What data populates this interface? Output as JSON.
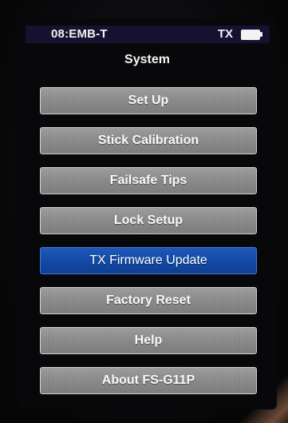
{
  "status_bar": {
    "model": "08:EMB-T",
    "mode": "TX",
    "battery_icon": "battery-full-icon"
  },
  "page": {
    "title": "System"
  },
  "menu": {
    "selected_index": 4,
    "items": [
      {
        "label": "Set Up"
      },
      {
        "label": "Stick Calibration"
      },
      {
        "label": "Failsafe Tips"
      },
      {
        "label": "Lock Setup"
      },
      {
        "label": "TX Firmware Update"
      },
      {
        "label": "Factory Reset"
      },
      {
        "label": "Help"
      },
      {
        "label": "About FS-G11P"
      }
    ]
  },
  "colors": {
    "status_bar_bg": "#141230",
    "button_gray": "#8a8a8a",
    "button_selected_blue": "#134aa6",
    "screen_bg": "#08080b"
  }
}
